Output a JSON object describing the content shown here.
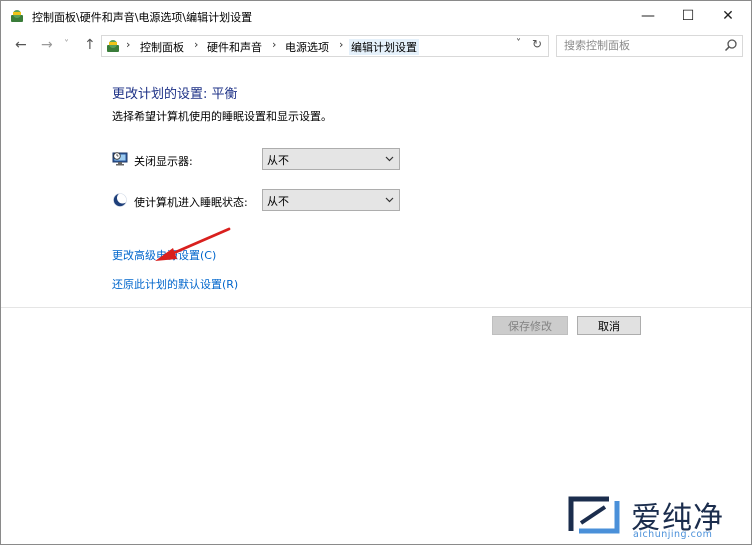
{
  "window": {
    "title": "控制面板\\硬件和声音\\电源选项\\编辑计划设置",
    "controls": {
      "minimize": "—",
      "maximize": "☐",
      "close": "✕"
    }
  },
  "nav": {
    "back": "←",
    "forward": "→",
    "recent": "˅",
    "up": "↑",
    "breadcrumb": [
      "控制面板",
      "硬件和声音",
      "电源选项",
      "编辑计划设置"
    ],
    "separator": "›",
    "dropdown": "˅",
    "refresh": "↻"
  },
  "search": {
    "placeholder": "搜索控制面板",
    "icon": "search-icon"
  },
  "main": {
    "heading": "更改计划的设置: 平衡",
    "description": "选择希望计算机使用的睡眠设置和显示设置。",
    "settings": [
      {
        "label": "关闭显示器:",
        "value": "从不",
        "icon": "monitor-icon"
      },
      {
        "label": "使计算机进入睡眠状态:",
        "value": "从不",
        "icon": "sleep-moon-icon"
      }
    ],
    "links": {
      "advanced": "更改高级电源设置(C)",
      "restore": "还原此计划的默认设置(R)"
    },
    "buttons": {
      "save": "保存修改",
      "cancel": "取消"
    }
  },
  "colors": {
    "heading": "#1e3287",
    "link": "#0066cc",
    "annotation_arrow": "#d9201e"
  },
  "watermark": {
    "text": "爱纯净",
    "sub": "aichunjing.com"
  }
}
